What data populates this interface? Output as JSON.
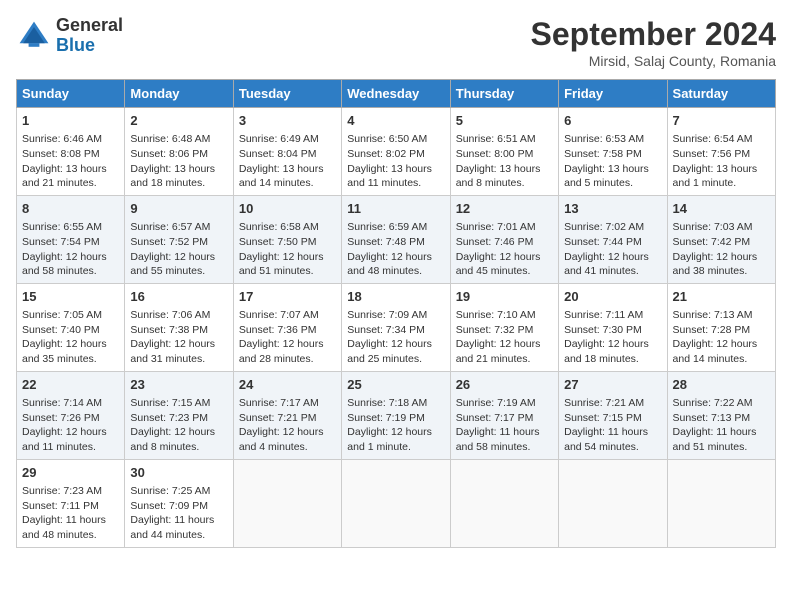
{
  "header": {
    "logo_line1": "General",
    "logo_line2": "Blue",
    "month_year": "September 2024",
    "location": "Mirsid, Salaj County, Romania"
  },
  "days_of_week": [
    "Sunday",
    "Monday",
    "Tuesday",
    "Wednesday",
    "Thursday",
    "Friday",
    "Saturday"
  ],
  "weeks": [
    [
      {
        "day": 1,
        "sunrise": "6:46 AM",
        "sunset": "8:08 PM",
        "daylight": "13 hours and 21 minutes."
      },
      {
        "day": 2,
        "sunrise": "6:48 AM",
        "sunset": "8:06 PM",
        "daylight": "13 hours and 18 minutes."
      },
      {
        "day": 3,
        "sunrise": "6:49 AM",
        "sunset": "8:04 PM",
        "daylight": "13 hours and 14 minutes."
      },
      {
        "day": 4,
        "sunrise": "6:50 AM",
        "sunset": "8:02 PM",
        "daylight": "13 hours and 11 minutes."
      },
      {
        "day": 5,
        "sunrise": "6:51 AM",
        "sunset": "8:00 PM",
        "daylight": "13 hours and 8 minutes."
      },
      {
        "day": 6,
        "sunrise": "6:53 AM",
        "sunset": "7:58 PM",
        "daylight": "13 hours and 5 minutes."
      },
      {
        "day": 7,
        "sunrise": "6:54 AM",
        "sunset": "7:56 PM",
        "daylight": "13 hours and 1 minute."
      }
    ],
    [
      {
        "day": 8,
        "sunrise": "6:55 AM",
        "sunset": "7:54 PM",
        "daylight": "12 hours and 58 minutes."
      },
      {
        "day": 9,
        "sunrise": "6:57 AM",
        "sunset": "7:52 PM",
        "daylight": "12 hours and 55 minutes."
      },
      {
        "day": 10,
        "sunrise": "6:58 AM",
        "sunset": "7:50 PM",
        "daylight": "12 hours and 51 minutes."
      },
      {
        "day": 11,
        "sunrise": "6:59 AM",
        "sunset": "7:48 PM",
        "daylight": "12 hours and 48 minutes."
      },
      {
        "day": 12,
        "sunrise": "7:01 AM",
        "sunset": "7:46 PM",
        "daylight": "12 hours and 45 minutes."
      },
      {
        "day": 13,
        "sunrise": "7:02 AM",
        "sunset": "7:44 PM",
        "daylight": "12 hours and 41 minutes."
      },
      {
        "day": 14,
        "sunrise": "7:03 AM",
        "sunset": "7:42 PM",
        "daylight": "12 hours and 38 minutes."
      }
    ],
    [
      {
        "day": 15,
        "sunrise": "7:05 AM",
        "sunset": "7:40 PM",
        "daylight": "12 hours and 35 minutes."
      },
      {
        "day": 16,
        "sunrise": "7:06 AM",
        "sunset": "7:38 PM",
        "daylight": "12 hours and 31 minutes."
      },
      {
        "day": 17,
        "sunrise": "7:07 AM",
        "sunset": "7:36 PM",
        "daylight": "12 hours and 28 minutes."
      },
      {
        "day": 18,
        "sunrise": "7:09 AM",
        "sunset": "7:34 PM",
        "daylight": "12 hours and 25 minutes."
      },
      {
        "day": 19,
        "sunrise": "7:10 AM",
        "sunset": "7:32 PM",
        "daylight": "12 hours and 21 minutes."
      },
      {
        "day": 20,
        "sunrise": "7:11 AM",
        "sunset": "7:30 PM",
        "daylight": "12 hours and 18 minutes."
      },
      {
        "day": 21,
        "sunrise": "7:13 AM",
        "sunset": "7:28 PM",
        "daylight": "12 hours and 14 minutes."
      }
    ],
    [
      {
        "day": 22,
        "sunrise": "7:14 AM",
        "sunset": "7:26 PM",
        "daylight": "12 hours and 11 minutes."
      },
      {
        "day": 23,
        "sunrise": "7:15 AM",
        "sunset": "7:23 PM",
        "daylight": "12 hours and 8 minutes."
      },
      {
        "day": 24,
        "sunrise": "7:17 AM",
        "sunset": "7:21 PM",
        "daylight": "12 hours and 4 minutes."
      },
      {
        "day": 25,
        "sunrise": "7:18 AM",
        "sunset": "7:19 PM",
        "daylight": "12 hours and 1 minute."
      },
      {
        "day": 26,
        "sunrise": "7:19 AM",
        "sunset": "7:17 PM",
        "daylight": "11 hours and 58 minutes."
      },
      {
        "day": 27,
        "sunrise": "7:21 AM",
        "sunset": "7:15 PM",
        "daylight": "11 hours and 54 minutes."
      },
      {
        "day": 28,
        "sunrise": "7:22 AM",
        "sunset": "7:13 PM",
        "daylight": "11 hours and 51 minutes."
      }
    ],
    [
      {
        "day": 29,
        "sunrise": "7:23 AM",
        "sunset": "7:11 PM",
        "daylight": "11 hours and 48 minutes."
      },
      {
        "day": 30,
        "sunrise": "7:25 AM",
        "sunset": "7:09 PM",
        "daylight": "11 hours and 44 minutes."
      },
      null,
      null,
      null,
      null,
      null
    ]
  ]
}
